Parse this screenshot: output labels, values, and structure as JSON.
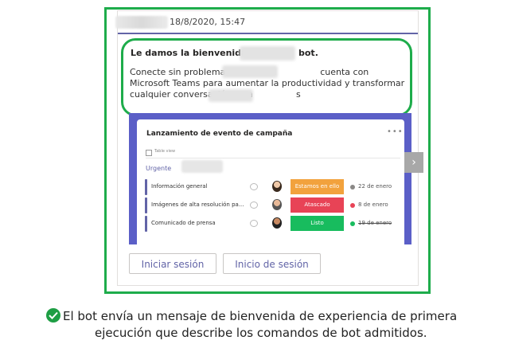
{
  "message_header": {
    "timestamp": "18/8/2020, 15:47"
  },
  "welcome": {
    "title_prefix": "Le damos la bienvenida a",
    "title_suffix": "bot.",
    "body_part1": "Conecte sin problemas su",
    "body_part2": "cuenta con Microsoft Teams para aumentar la productividad y transformar cualquier conversación en",
    "body_part3": "a",
    "body_part4": "s"
  },
  "event_card": {
    "title": "Lanzamiento de evento de campaña",
    "more_icon": "more-horizontal-icon",
    "table_label": "Table view",
    "group_label": "Urgente",
    "rows": [
      {
        "label": "Información general",
        "status": "Estamos en ello",
        "status_color": "#f2a23d",
        "date": "22 de enero",
        "date_icon_color": "#8a8886",
        "struck": false
      },
      {
        "label": "Imágenes de alta resolución pa...",
        "status": "Atascado",
        "status_color": "#e84356",
        "date": "8 de enero",
        "date_icon_color": "#e84356",
        "struck": false
      },
      {
        "label": "Comunicado de prensa",
        "status": "Listo",
        "status_color": "#18bc5e",
        "date": "19 de enero",
        "date_icon_color": "#18bc5e",
        "struck": true
      }
    ],
    "next_arrow_icon": "chevron-right-icon"
  },
  "actions": {
    "sign_in_label": "Iniciar sesión",
    "login_label": "Inicio de sesión"
  },
  "caption": {
    "icon": "check-circle-icon",
    "line1": "El bot envía un mensaje de bienvenida de experiencia de primera",
    "line2": "ejecución que describe los comandos de bot admitidos."
  },
  "colors": {
    "highlight_green": "#1eac4b",
    "teams_purple": "#5b5fc7",
    "accent": "#6264a7"
  }
}
